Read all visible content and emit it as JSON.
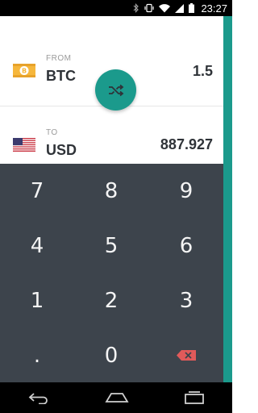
{
  "status_bar": {
    "time": "23:27",
    "icons": [
      "bluetooth-icon",
      "vibrate-icon",
      "wifi-icon",
      "signal-icon",
      "battery-icon"
    ]
  },
  "converter": {
    "from": {
      "label": "FROM",
      "currency": "BTC",
      "amount": "1.5",
      "flag": "bitcoin-flag"
    },
    "to": {
      "label": "TO",
      "currency": "USD",
      "amount": "887.927",
      "flag": "us-flag"
    },
    "swap_icon": "shuffle-icon"
  },
  "keypad": {
    "keys": [
      "7",
      "8",
      "9",
      "4",
      "5",
      "6",
      "1",
      "2",
      "3",
      ".",
      "0"
    ],
    "backspace_icon": "backspace-icon"
  },
  "nav_bar": {
    "icons": [
      "back-icon",
      "home-icon",
      "recents-icon"
    ]
  },
  "colors": {
    "accent": "#1b9a8c",
    "keypad_bg": "#3d444c",
    "backspace": "#e05a5a",
    "text_dark": "#2f3338",
    "text_muted": "#9a9a9a"
  }
}
